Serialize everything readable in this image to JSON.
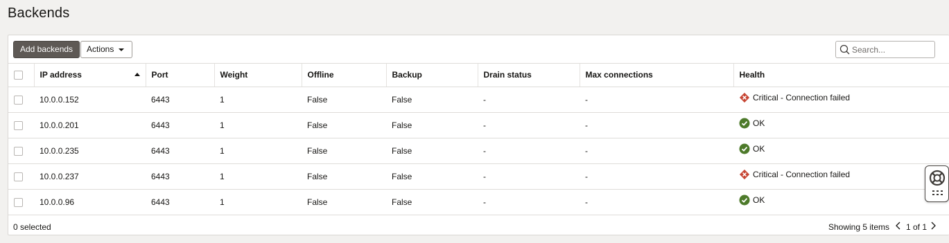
{
  "page": {
    "title": "Backends"
  },
  "toolbar": {
    "add_label": "Add backends",
    "actions_label": "Actions",
    "search_placeholder": "Search..."
  },
  "table": {
    "columns": [
      "IP address",
      "Port",
      "Weight",
      "Offline",
      "Backup",
      "Drain status",
      "Max connections",
      "Health"
    ],
    "sort": {
      "column": "IP address",
      "direction": "ascending"
    },
    "rows": [
      {
        "ip": "10.0.0.152",
        "port": "6443",
        "weight": "1",
        "offline": "False",
        "backup": "False",
        "drain": "-",
        "maxconn": "-",
        "health": "Critical - Connection failed",
        "health_status": "critical"
      },
      {
        "ip": "10.0.0.201",
        "port": "6443",
        "weight": "1",
        "offline": "False",
        "backup": "False",
        "drain": "-",
        "maxconn": "-",
        "health": "OK",
        "health_status": "ok"
      },
      {
        "ip": "10.0.0.235",
        "port": "6443",
        "weight": "1",
        "offline": "False",
        "backup": "False",
        "drain": "-",
        "maxconn": "-",
        "health": "OK",
        "health_status": "ok"
      },
      {
        "ip": "10.0.0.237",
        "port": "6443",
        "weight": "1",
        "offline": "False",
        "backup": "False",
        "drain": "-",
        "maxconn": "-",
        "health": "Critical - Connection failed",
        "health_status": "critical"
      },
      {
        "ip": "10.0.0.96",
        "port": "6443",
        "weight": "1",
        "offline": "False",
        "backup": "False",
        "drain": "-",
        "maxconn": "-",
        "health": "OK",
        "health_status": "ok"
      }
    ]
  },
  "footer": {
    "selected": "0 selected",
    "showing": "Showing 5 items",
    "page": "1 of 1"
  },
  "icons": {
    "critical": "critical-status-icon",
    "ok": "ok-status-icon",
    "search": "search-icon",
    "help": "lifebuoy-icon",
    "apps": "app-grid-icon"
  },
  "colors": {
    "critical": "#c74634",
    "ok": "#4d7a2a",
    "primary_button": "#5e5955"
  }
}
